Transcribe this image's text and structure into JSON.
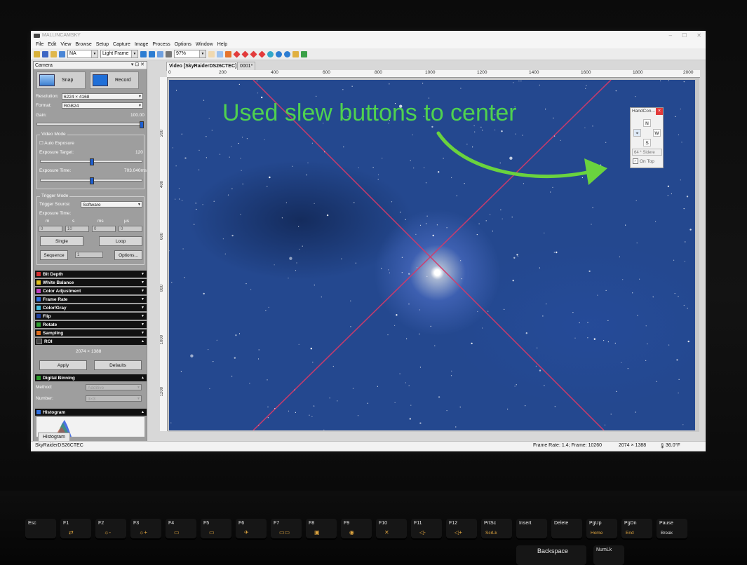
{
  "app": {
    "title": "MALLINCAMSKY",
    "menu": [
      "File",
      "Edit",
      "View",
      "Browse",
      "Setup",
      "Capture",
      "Image",
      "Process",
      "Options",
      "Window",
      "Help"
    ],
    "toolbar": {
      "na_select": "NA",
      "frame_select": "Light Frame",
      "zoom_select": "97%"
    }
  },
  "camera_panel": {
    "title": "Camera",
    "snap_label": "Snap",
    "record_label": "Record",
    "resolution_label": "Resolution:",
    "resolution_value": "6224 × 4168",
    "format_label": "Format:",
    "format_value": "RGB24",
    "gain_label": "Gain:",
    "gain_value": "100.00",
    "video_mode": {
      "title": "Video Mode",
      "auto_exposure": "Auto Exposure",
      "exposure_target_label": "Exposure Target:",
      "exposure_target_value": "120",
      "exposure_time_label": "Exposure Time:",
      "exposure_time_value": "703.040ms"
    },
    "trigger_mode": {
      "title": "Trigger Mode",
      "source_label": "Trigger Source:",
      "source_value": "Software",
      "exposure_time_label": "Exposure Time:",
      "units": [
        "m",
        "s",
        "ms",
        "μs"
      ],
      "fields": [
        "0",
        "10",
        "0",
        "0"
      ],
      "single_label": "Single",
      "loop_label": "Loop",
      "sequence_label": "Sequence",
      "sequence_value": "1",
      "options_label": "Options..."
    },
    "sections": [
      "Bit Depth",
      "White Balance",
      "Color Adjustment",
      "Frame Rate",
      "Color/Gray",
      "Flip",
      "Rotate",
      "Sampling",
      "ROI"
    ],
    "section_colors": [
      "#d63030",
      "#e0c020",
      "#c040c0",
      "#3070e0",
      "#40c0e0",
      "#2040a0",
      "#30a030",
      "#e07020",
      "#404040"
    ],
    "roi": {
      "size": "2074 × 1388",
      "apply_label": "Apply",
      "defaults_label": "Defaults"
    },
    "digital_binning": {
      "title": "Digital Binning",
      "method_label": "Method:",
      "method_value": "Additive",
      "number_label": "Number:",
      "number_value": "3×3"
    },
    "histogram": {
      "title": "Histogram",
      "tab_label": "Histogram"
    }
  },
  "document": {
    "tab_active": "Video [SkyRaiderDS26CTEC]",
    "tab_other": "0001*",
    "ruler_h": [
      "0",
      "200",
      "400",
      "600",
      "800",
      "1000",
      "1200",
      "1400",
      "1600",
      "1800",
      "2000"
    ],
    "ruler_v": [
      "200",
      "400",
      "600",
      "800",
      "1000",
      "1200"
    ]
  },
  "annotation": {
    "text": "Used slew buttons to center",
    "color": "#4fd24f"
  },
  "hand_controller": {
    "title": "HandCon...",
    "close": "×",
    "north": "N",
    "west": "W",
    "south": "S",
    "rate_value": "64 * Sidere",
    "on_top_label": "On Top"
  },
  "status": {
    "camera": "SkyRaiderDS26CTEC",
    "frame_info": "Frame Rate: 1.4; Frame: 10260",
    "resolution": "2074 × 1388",
    "temperature": "36.0°F"
  },
  "keyboard": {
    "keys": [
      "Esc",
      "F1",
      "F2",
      "F3",
      "F4",
      "F5",
      "F6",
      "F7",
      "F8",
      "F9",
      "F10",
      "F11",
      "F12",
      "PrtSc",
      "Insert",
      "Delete",
      "PgUp",
      "PgDn",
      "Pause"
    ],
    "sub_labels": [
      "",
      "",
      "",
      "",
      "",
      "",
      "",
      "",
      "",
      "",
      "",
      "",
      "",
      "ScrLk",
      "",
      "",
      "Home",
      "End",
      "Break"
    ],
    "backspace": "Backspace",
    "numlock": "NumLk"
  }
}
